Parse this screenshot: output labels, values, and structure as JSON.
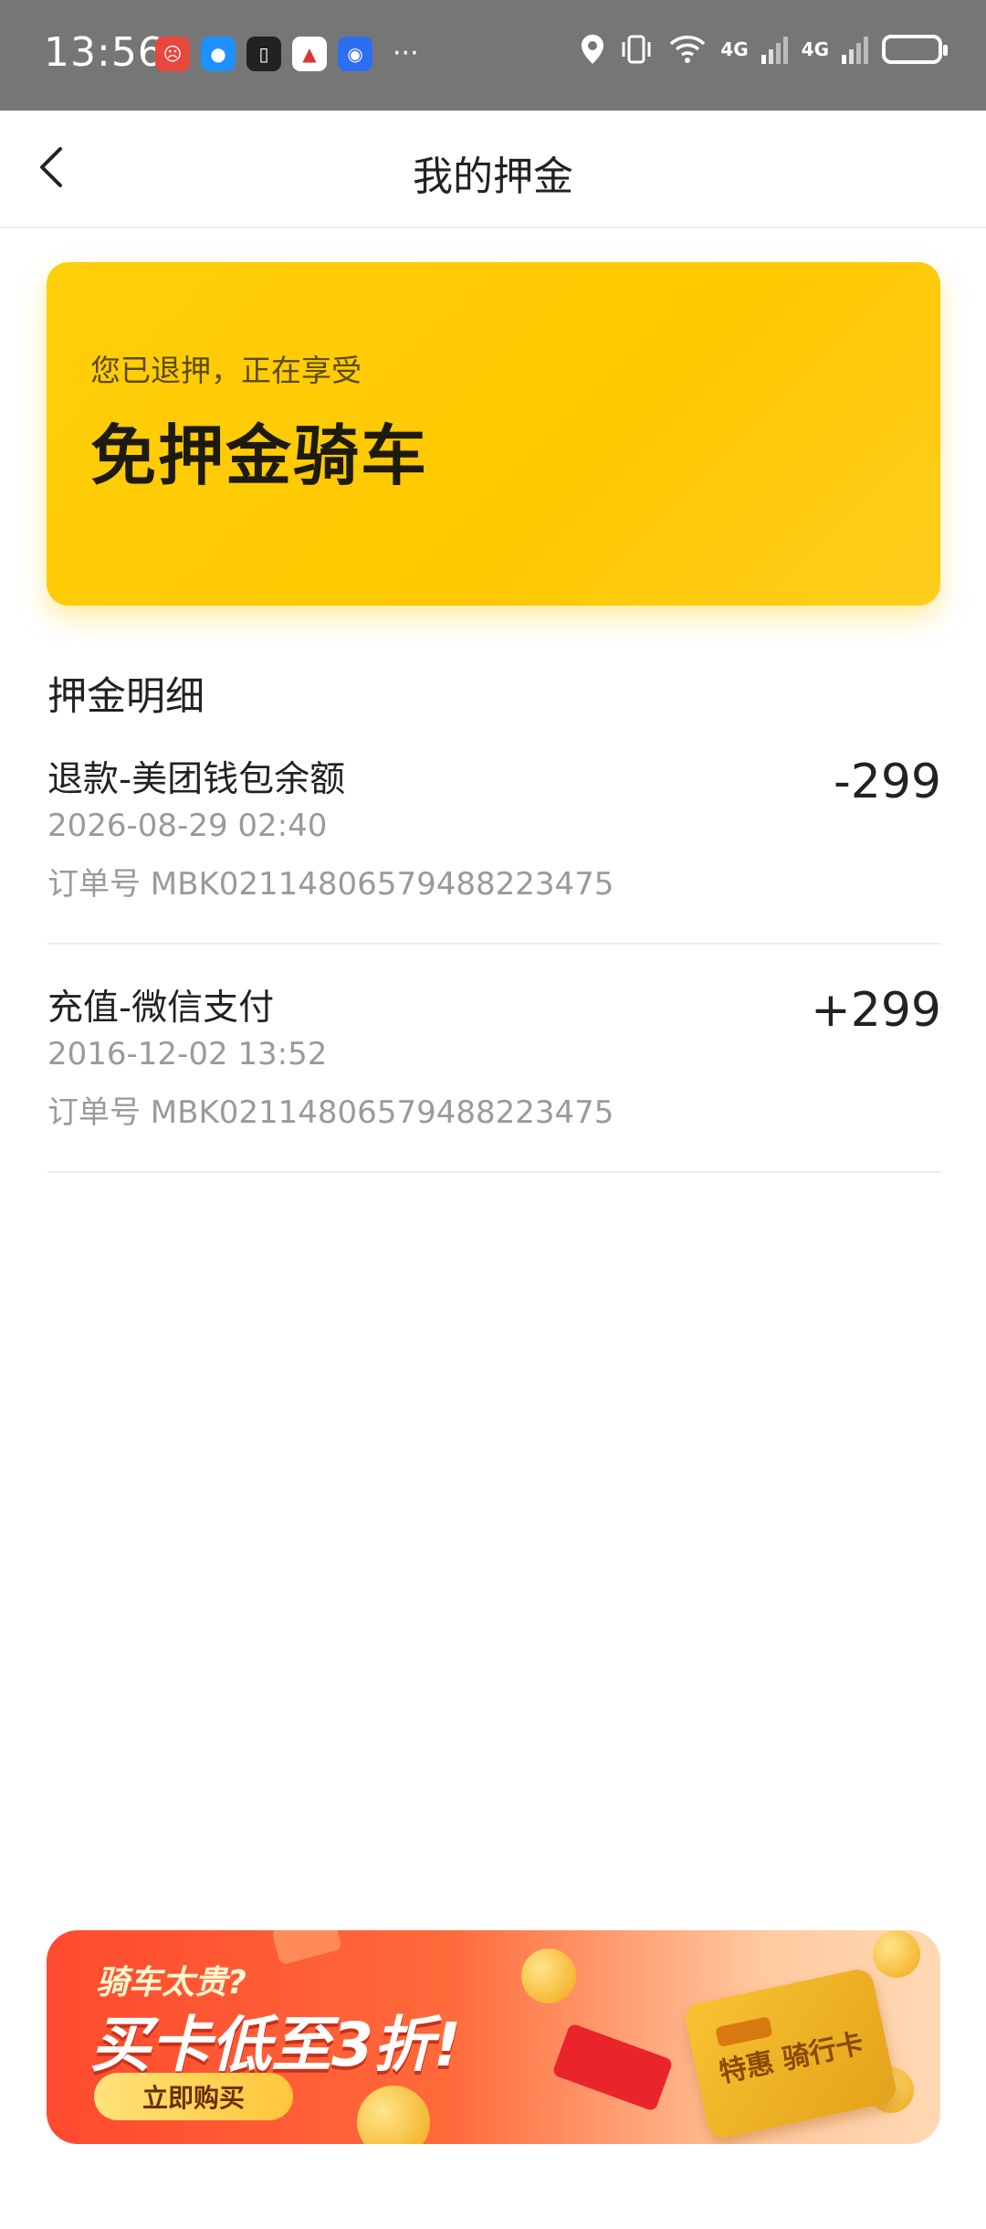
{
  "status_bar": {
    "time": "13:56",
    "signal1": "4G",
    "signal2": "4G",
    "icons": [
      "app-notification-icon",
      "message-icon",
      "phone-app-icon",
      "music-app-icon",
      "browser-app-icon",
      "more-dots-icon",
      "location-icon",
      "vibrate-icon",
      "wifi-icon",
      "signal-icon",
      "battery-icon"
    ],
    "more": "···"
  },
  "nav": {
    "title": "我的押金"
  },
  "deposit_card": {
    "subtitle": "您已退押，正在享受",
    "title": "免押金骑车",
    "accent_color": "#ffc800"
  },
  "details": {
    "section_title": "押金明细",
    "items": [
      {
        "title": "退款-美团钱包余额",
        "date": "2026-08-29 02:40",
        "order": "订单号 MBK021148065794882234​75",
        "amount": "-299"
      },
      {
        "title": "充值-微信支付",
        "date": "2016-12-02 13:52",
        "order": "订单号 MBK02114806579488223475",
        "amount": "+299"
      }
    ]
  },
  "banner": {
    "question": "骑车太贵?",
    "headline": "买卡低至3折!",
    "button": "立即购买",
    "card_text": "特惠 骑行卡"
  }
}
